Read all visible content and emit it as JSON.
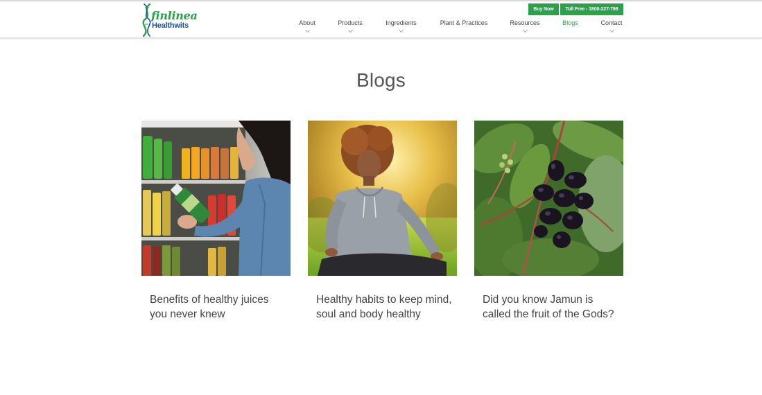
{
  "brand": {
    "name": "finlinea",
    "sub": "Healthwits",
    "green": "#2aa14a",
    "blue": "#1f4fa0"
  },
  "cta": {
    "buy_now": "Buy Now",
    "toll_free": "Toll Free - 1800-227-798"
  },
  "nav": {
    "items": [
      {
        "label": "About",
        "dropdown": true
      },
      {
        "label": "Products",
        "dropdown": true
      },
      {
        "label": "Ingredients",
        "dropdown": true
      },
      {
        "label": "Plant & Practices",
        "dropdown": false
      },
      {
        "label": "Resources",
        "dropdown": true
      },
      {
        "label": "Blogs",
        "dropdown": false,
        "active": true
      },
      {
        "label": "Contact",
        "dropdown": true
      }
    ]
  },
  "page": {
    "title": "Blogs"
  },
  "blogs": [
    {
      "title": "Benefits of healthy juices you never knew",
      "image": "woman-holding-juice-bottle"
    },
    {
      "title": "Healthy habits to keep mind, soul and body healthy",
      "image": "woman-meditating-outdoors"
    },
    {
      "title": "Did you know Jamun is called the fruit of the Gods?",
      "image": "jamun-fruit-on-tree"
    }
  ]
}
